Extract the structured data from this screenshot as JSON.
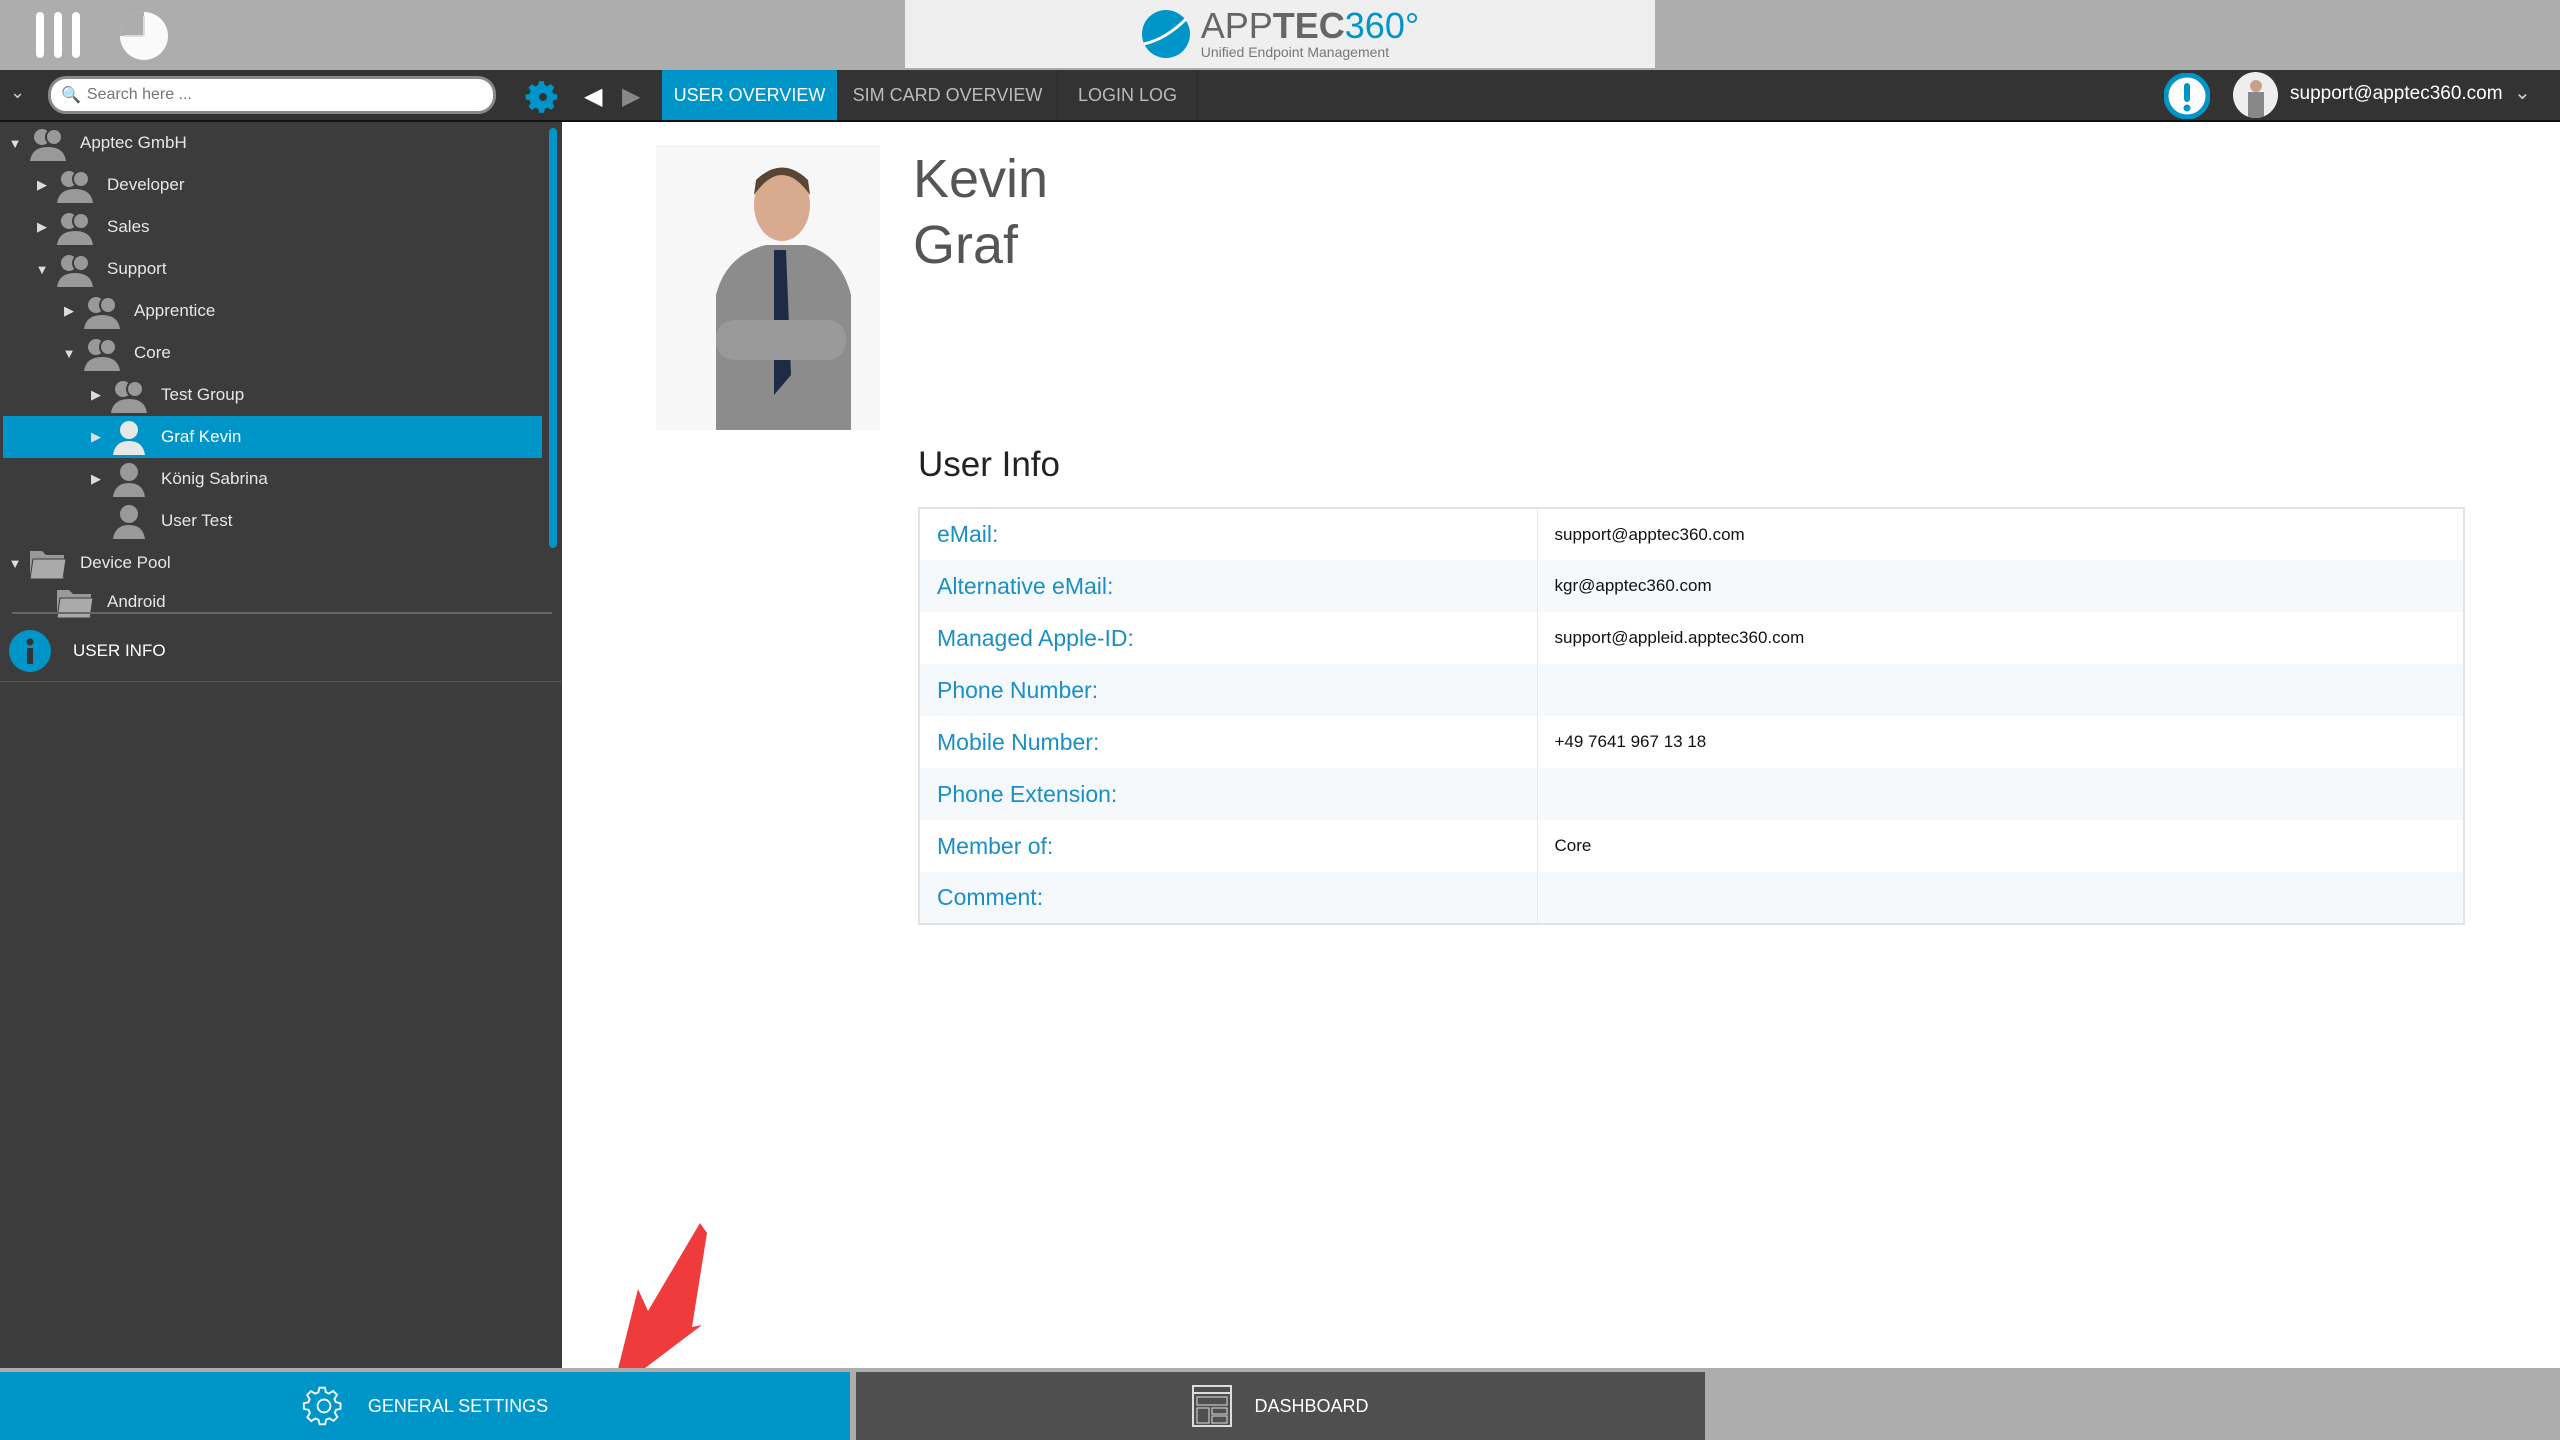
{
  "header": {
    "logo_text_light": "APP",
    "logo_text_bold": "TEC",
    "logo_text_num": "360°",
    "logo_subtitle": "Unified Endpoint Management",
    "accent": "#0095c8"
  },
  "nav": {
    "search_placeholder": "Search here ...",
    "tabs": [
      {
        "label": "USER OVERVIEW",
        "active": true
      },
      {
        "label": "SIM CARD OVERVIEW"
      },
      {
        "label": "LOGIN LOG"
      }
    ],
    "user_email": "support@apptec360.com"
  },
  "sidebar": {
    "tree": [
      {
        "label": "Apptec GmbH",
        "icon": "group-icon",
        "caret": "down"
      },
      {
        "label": "Developer",
        "icon": "group-icon",
        "caret": "right"
      },
      {
        "label": "Sales",
        "icon": "group-icon",
        "caret": "right"
      },
      {
        "label": "Support",
        "icon": "group-icon",
        "caret": "down"
      },
      {
        "label": "Apprentice",
        "icon": "group-icon",
        "caret": "right"
      },
      {
        "label": "Core",
        "icon": "group-icon",
        "caret": "down"
      },
      {
        "label": "Test Group",
        "icon": "group-icon",
        "caret": "right"
      },
      {
        "label": "Graf Kevin",
        "icon": "user-icon",
        "caret": "right",
        "selected": true
      },
      {
        "label": "König Sabrina",
        "icon": "user-icon",
        "caret": "right"
      },
      {
        "label": "User Test",
        "icon": "user-icon",
        "caret": ""
      },
      {
        "label": "Device Pool",
        "icon": "folder-icon",
        "caret": "down"
      },
      {
        "label": "Android",
        "icon": "folder-icon",
        "caret": ""
      }
    ],
    "user_info_label": "USER INFO"
  },
  "profile": {
    "first_name": "Kevin",
    "last_name": "Graf",
    "section_title": "User Info",
    "fields": [
      {
        "label": "eMail:",
        "value": "support@apptec360.com"
      },
      {
        "label": "Alternative eMail:",
        "value": "kgr@apptec360.com"
      },
      {
        "label": "Managed Apple-ID:",
        "value": "support@appleid.apptec360.com"
      },
      {
        "label": "Phone Number:",
        "value": ""
      },
      {
        "label": "Mobile Number:",
        "value": "+49 7641 967 13 18"
      },
      {
        "label": "Phone Extension:",
        "value": ""
      },
      {
        "label": "Member of:",
        "value": "Core"
      },
      {
        "label": "Comment:",
        "value": ""
      }
    ]
  },
  "bottom": {
    "general_settings": "GENERAL SETTINGS",
    "dashboard": "DASHBOARD"
  }
}
